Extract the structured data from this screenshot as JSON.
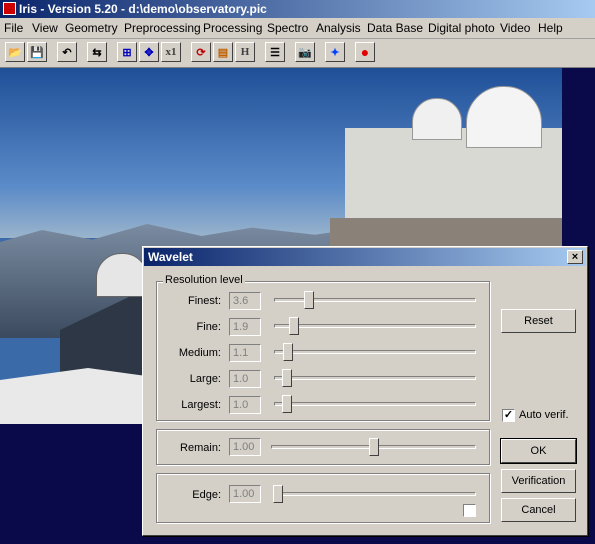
{
  "window": {
    "title": "Iris - Version 5.20 - d:\\demo\\observatory.pic"
  },
  "menu": [
    "File",
    "View",
    "Geometry",
    "Preprocessing",
    "Processing",
    "Spectro",
    "Analysis",
    "Data Base",
    "Digital photo",
    "Video",
    "Help"
  ],
  "toolbar": [
    {
      "icon": "open-folder-icon",
      "glyph": "📂"
    },
    {
      "icon": "save-icon",
      "glyph": "💾"
    },
    {
      "icon": "undo-icon",
      "glyph": "↶"
    },
    {
      "icon": "swap-icon",
      "glyph": "⇆"
    },
    {
      "icon": "zoom-in-icon",
      "glyph": "⊞"
    },
    {
      "icon": "zoom-out-icon",
      "glyph": "✥"
    },
    {
      "icon": "zoom-x1-icon",
      "glyph": "x1"
    },
    {
      "icon": "red-circle-arrows-icon",
      "glyph": "⟳"
    },
    {
      "icon": "frame-icon",
      "glyph": "▤"
    },
    {
      "icon": "histogram-h-icon",
      "glyph": "H"
    },
    {
      "icon": "list-icon",
      "glyph": "☰"
    },
    {
      "icon": "camera-icon",
      "glyph": "📷"
    },
    {
      "icon": "blue-diamond-icon",
      "glyph": "✦"
    },
    {
      "icon": "red-dot-icon",
      "glyph": "●"
    }
  ],
  "dialog": {
    "title": "Wavelet",
    "close": "×",
    "resolution_group": "Resolution level",
    "levels": [
      {
        "label": "Finest:",
        "value": "3.6",
        "level": 0.155
      },
      {
        "label": "Fine:",
        "value": "1.9",
        "level": 0.08
      },
      {
        "label": "Medium:",
        "value": "1.1",
        "level": 0.045
      },
      {
        "label": "Large:",
        "value": "1.0",
        "level": 0.04
      },
      {
        "label": "Largest:",
        "value": "1.0",
        "level": 0.04
      }
    ],
    "remain": {
      "label": "Remain:",
      "value": "1.00",
      "level": 0.5
    },
    "edge": {
      "label": "Edge:",
      "value": "1.00",
      "level": 0.0
    },
    "edge_checked": false,
    "reset": "Reset",
    "auto_verif": "Auto verif.",
    "auto_verif_checked": true,
    "ok": "OK",
    "verification": "Verification",
    "cancel": "Cancel"
  }
}
